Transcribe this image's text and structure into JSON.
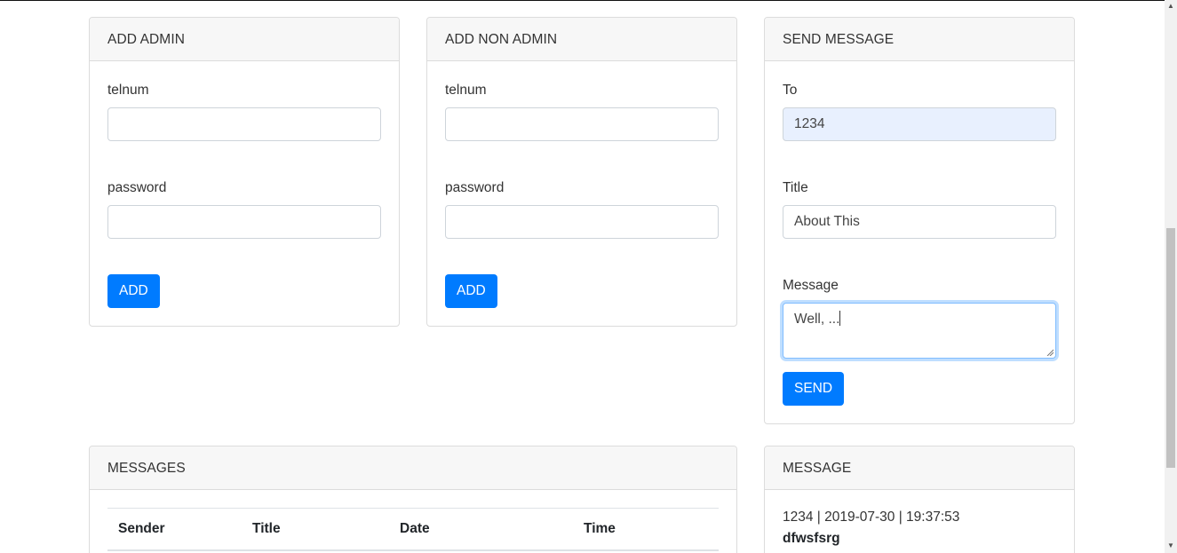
{
  "add_admin": {
    "header": "ADD ADMIN",
    "telnum_label": "telnum",
    "telnum_value": "",
    "password_label": "password",
    "password_value": "",
    "button_label": "ADD"
  },
  "add_non_admin": {
    "header": "ADD NON ADMIN",
    "telnum_label": "telnum",
    "telnum_value": "",
    "password_label": "password",
    "password_value": "",
    "button_label": "ADD"
  },
  "send_message": {
    "header": "SEND MESSAGE",
    "to_label": "To",
    "to_value": "1234",
    "title_label": "Title",
    "title_value": "About This",
    "message_label": "Message",
    "message_value": "Well, ...",
    "button_label": "SEND"
  },
  "messages": {
    "header": "MESSAGES",
    "columns": [
      "Sender",
      "Title",
      "Date",
      "Time"
    ]
  },
  "message": {
    "header": "MESSAGE",
    "meta": "1234 | 2019-07-30 | 19:37:53",
    "title": "dfwsfsrg"
  },
  "colors": {
    "primary": "#007bff",
    "autofill": "#e8f0fe",
    "header_bg": "#f7f7f7"
  }
}
